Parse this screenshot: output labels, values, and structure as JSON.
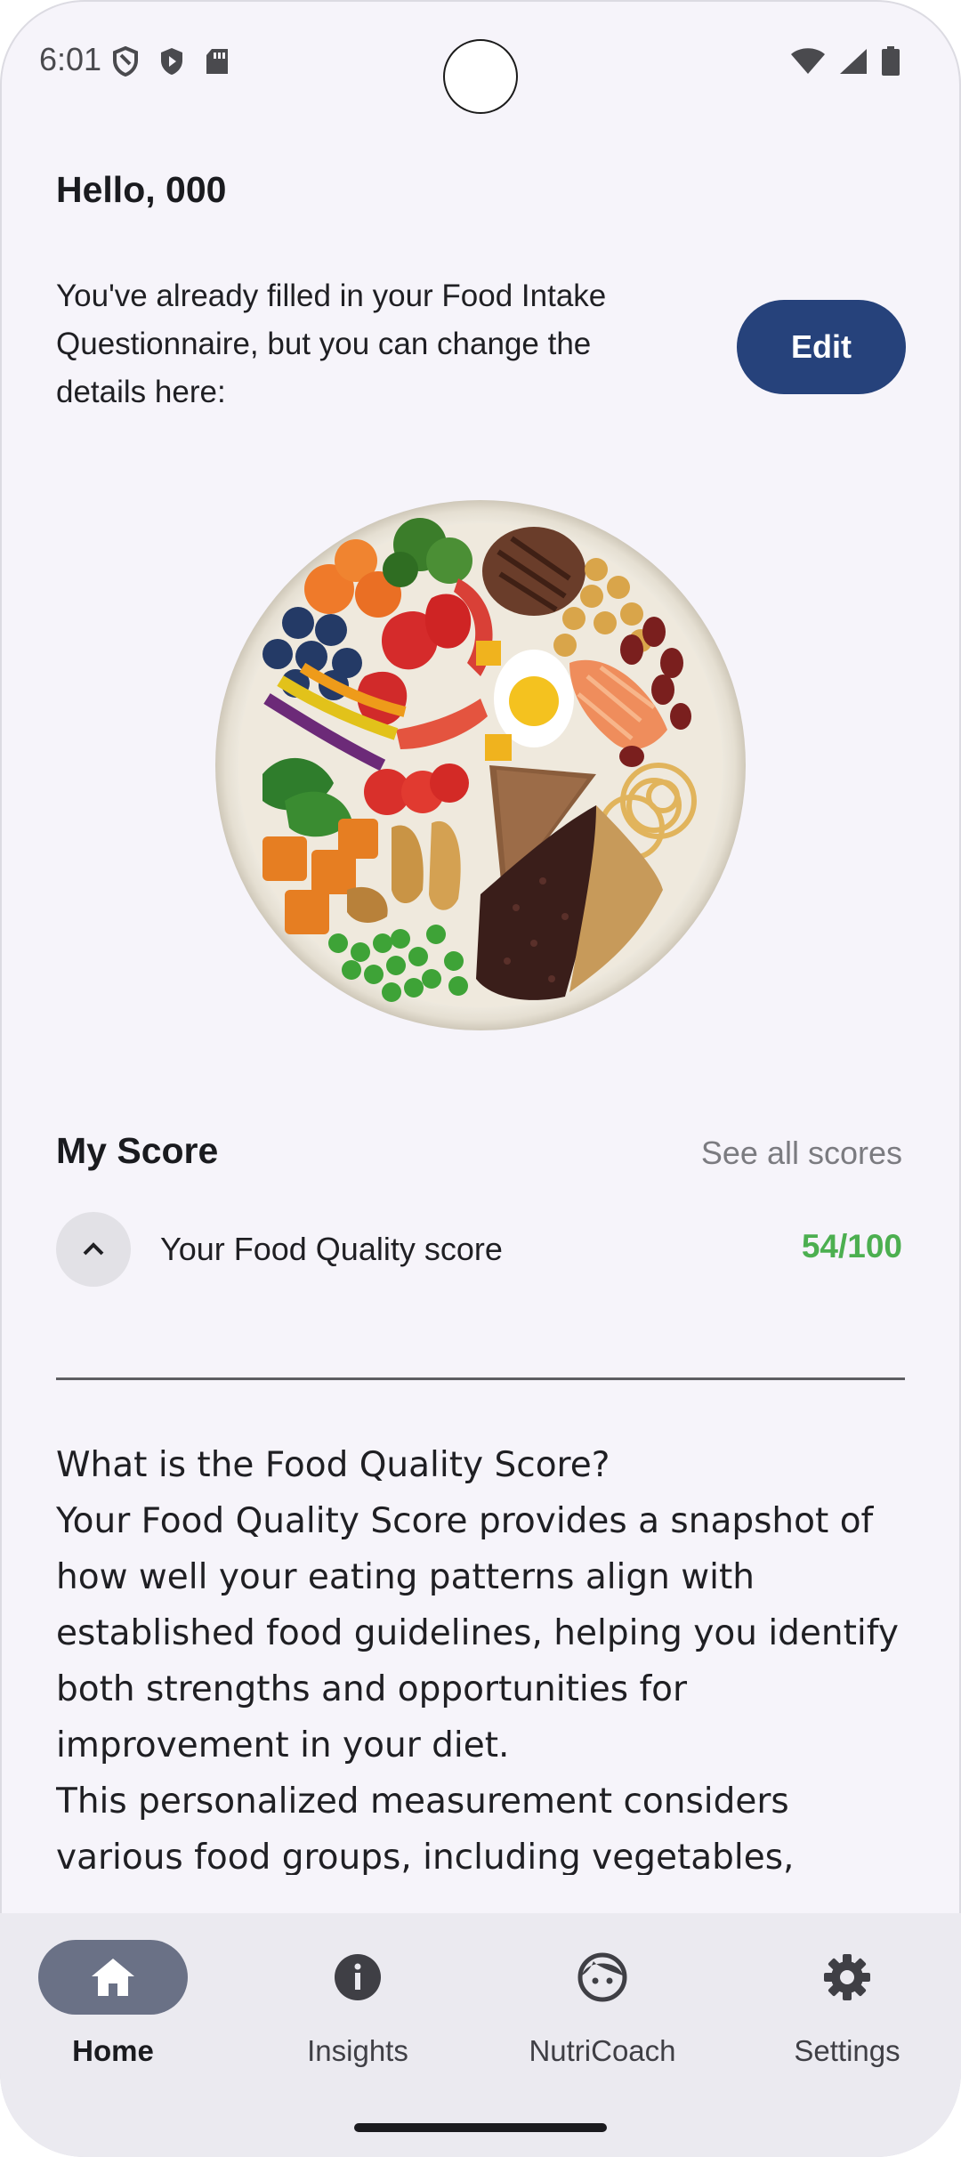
{
  "status_bar": {
    "time": "6:01",
    "left_icons": [
      "shield-outline-icon",
      "shield-play-icon",
      "sd-card-icon"
    ],
    "right_icons": [
      "wifi-icon",
      "signal-icon",
      "battery-icon"
    ]
  },
  "header": {
    "greeting": "Hello, 000"
  },
  "questionnaire": {
    "text": "You've already filled in your Food Intake Questionnaire, but you can change the details here:",
    "edit_label": "Edit"
  },
  "score": {
    "heading": "My Score",
    "see_all_label": "See all scores",
    "item_label": "Your Food Quality score",
    "value": "54/100",
    "value_color": "#4caf50"
  },
  "explanation": {
    "paragraphs": [
      "What is the Food Quality Score?",
      "Your Food Quality Score provides a snapshot of how well your eating patterns align with established food guidelines, helping you identify both strengths and opportunities for improvement in your diet.",
      "This personalized measurement considers various food groups, including vegetables,"
    ]
  },
  "nav": {
    "items": [
      {
        "label": "Home",
        "icon": "home-icon",
        "active": true
      },
      {
        "label": "Insights",
        "icon": "info-icon",
        "active": false
      },
      {
        "label": "NutriCoach",
        "icon": "face-icon",
        "active": false
      },
      {
        "label": "Settings",
        "icon": "gear-icon",
        "active": false
      }
    ]
  },
  "colors": {
    "accent": "#26427b",
    "background": "#f6f4fa",
    "nav_active": "#6a7186"
  }
}
